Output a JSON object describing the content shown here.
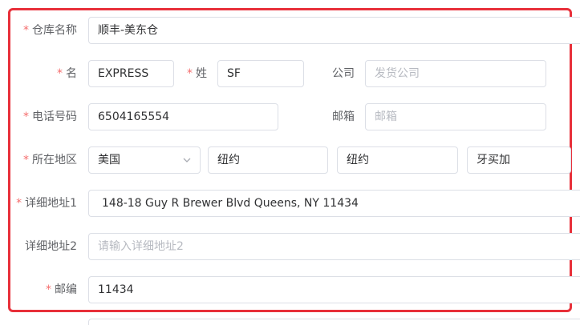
{
  "form": {
    "warehouse_name": {
      "label": "仓库名称",
      "required": "*",
      "value": "顺丰-美东仓"
    },
    "first_name": {
      "label": "名",
      "required": "*",
      "value": "EXPRESS"
    },
    "last_name": {
      "label": "姓",
      "required": "*",
      "value": "SF"
    },
    "company": {
      "label": "公司",
      "placeholder": "发货公司"
    },
    "phone": {
      "label": "电话号码",
      "required": "*",
      "value": "6504165554"
    },
    "email": {
      "label": "邮箱",
      "placeholder": "邮箱"
    },
    "region": {
      "label": "所在地区",
      "required": "*",
      "country": "美国",
      "state": "纽约",
      "city": "纽约",
      "district": "牙买加",
      "country_dropdown_icon": "chevron-down-icon"
    },
    "address1": {
      "label": "详细地址1",
      "required": "*",
      "value": "148-18 Guy R Brewer Blvd Queens, NY 11434"
    },
    "address2": {
      "label": "详细地址2",
      "placeholder": "请输入详细地址2"
    },
    "zipcode": {
      "label": "邮编",
      "required": "*",
      "value": "11434"
    }
  },
  "colors": {
    "highlight_border": "#e8303a",
    "required_mark": "#f56c6c",
    "input_border": "#dcdfe6",
    "placeholder": "#b7bac1"
  }
}
